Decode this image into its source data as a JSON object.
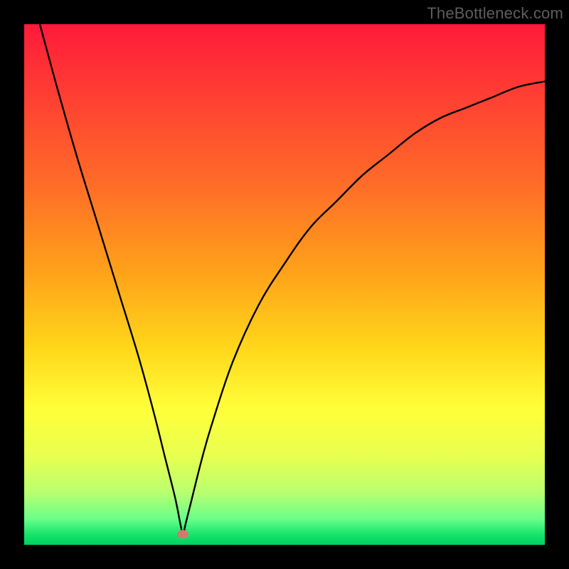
{
  "watermark": "TheBottleneck.com",
  "colors": {
    "frame": "#000000",
    "curve": "#000000",
    "marker": "#cf7b6c",
    "watermark": "#5d5d5d"
  },
  "chart_data": {
    "type": "line",
    "title": "",
    "xlabel": "",
    "ylabel": "",
    "xlim": [
      0,
      100
    ],
    "ylim": [
      0,
      100
    ],
    "grid": false,
    "legend": false,
    "marker": {
      "x": 30.5,
      "y": 2
    },
    "series": [
      {
        "name": "curve",
        "x": [
          3,
          6,
          10,
          14,
          18,
          22,
          25,
          27,
          29,
          30,
          30.5,
          31,
          32,
          34,
          36,
          40,
          45,
          50,
          55,
          60,
          65,
          70,
          75,
          80,
          85,
          90,
          95,
          100
        ],
        "y": [
          100,
          89,
          75,
          62,
          49,
          36,
          25,
          17,
          9,
          4,
          2,
          4,
          8,
          16,
          23,
          35,
          46,
          54,
          61,
          66,
          71,
          75,
          79,
          82,
          84,
          86,
          88,
          89
        ]
      }
    ]
  }
}
